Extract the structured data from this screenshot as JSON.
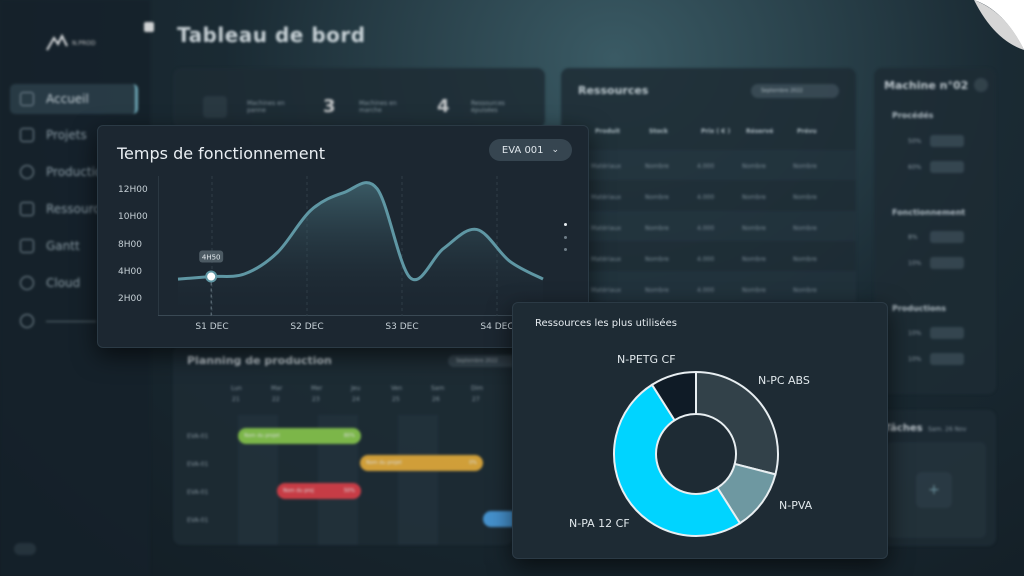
{
  "app": {
    "logo_text": "N.PROD",
    "page_title": "Tableau de bord"
  },
  "sidebar": {
    "items": [
      {
        "label": "Accueil",
        "icon": "home-icon"
      },
      {
        "label": "Projets",
        "icon": "folder-icon"
      },
      {
        "label": "Production",
        "icon": "gear-icon"
      },
      {
        "label": "Ressources",
        "icon": "bolt-icon"
      },
      {
        "label": "Gantt",
        "icon": "calendar-icon"
      },
      {
        "label": "Cloud",
        "icon": "cloud-icon"
      },
      {
        "label": "",
        "icon": "search-icon"
      }
    ]
  },
  "stats": [
    {
      "value": "",
      "label": "Machines en panne"
    },
    {
      "value": "3",
      "label": "Machines en marche"
    },
    {
      "value": "4",
      "label": "Ressources épuisées"
    }
  ],
  "resources_panel": {
    "title": "Ressources",
    "month": "Septembre 2022",
    "columns": [
      "Produit",
      "Stock",
      "Prix ( € )",
      "Réservé",
      "Prévu"
    ],
    "rows": [
      [
        "Matériaux",
        "Nombre",
        "4.000",
        "Nombre",
        "Nombre"
      ],
      [
        "Matériaux",
        "Nombre",
        "4.000",
        "Nombre",
        "Nombre"
      ],
      [
        "Matériaux",
        "Nombre",
        "4.000",
        "Nombre",
        "Nombre"
      ],
      [
        "Matériaux",
        "Nombre",
        "4.000",
        "Nombre",
        "Nombre"
      ],
      [
        "Matériaux",
        "Nombre",
        "4.000",
        "Nombre",
        "Nombre"
      ]
    ]
  },
  "machine_panel": {
    "title": "Machine n°02",
    "sections": [
      {
        "title": "Procédés",
        "rows": [
          "50%",
          "60%"
        ]
      },
      {
        "title": "Fonctionnement",
        "rows": [
          "8%",
          "10%"
        ]
      },
      {
        "title": "Productions",
        "rows": [
          "10%",
          "10%"
        ]
      }
    ]
  },
  "tasks_panel": {
    "title": "Tâches",
    "subtitle": "Sam. 26 Nov",
    "add": "+"
  },
  "planning": {
    "title": "Planning de production",
    "month": "Septembre 2022",
    "days": [
      [
        "Lun",
        "21"
      ],
      [
        "Mar",
        "22"
      ],
      [
        "Mer",
        "23"
      ],
      [
        "Jeu",
        "24"
      ],
      [
        "Ven",
        "25"
      ],
      [
        "Sam",
        "26"
      ],
      [
        "Dim",
        "27"
      ]
    ],
    "rows": [
      "EVA-01",
      "EVA-01",
      "EVA-01",
      "EVA-01"
    ],
    "bars": [
      {
        "label": "Nom du projet",
        "pct": "80%",
        "color": "#8fd14f"
      },
      {
        "label": "Nom du projet",
        "pct": "0%",
        "color": "#f2b53b"
      },
      {
        "label": "Nom du proj",
        "pct": "50%",
        "color": "#e8424b"
      },
      {
        "label": "",
        "pct": "",
        "color": "#4fa6ea"
      }
    ]
  },
  "uptime_card": {
    "title": "Temps de fonctionnement",
    "selector": "EVA 001",
    "tooltip": "4H50",
    "chart_data": {
      "type": "area",
      "title": "Temps de fonctionnement",
      "yticks": [
        "12H00",
        "10H00",
        "8H00",
        "4H00",
        "2H00"
      ],
      "xticks": [
        "S1 DEC",
        "S2 DEC",
        "S3 DEC",
        "S4 DEC"
      ],
      "series": [
        {
          "values": [
            4.4,
            4.6,
            4.8,
            6.5,
            9.8,
            11.2,
            11.5,
            4.5,
            6.8,
            8.3,
            5.8,
            4.4
          ]
        }
      ],
      "highlight": {
        "label": "4H50"
      }
    }
  },
  "donut_card": {
    "title": "Ressources les plus utilisées",
    "chart_data": {
      "type": "pie",
      "labels": [
        "N-PC ABS",
        "N-PVA",
        "N-PA 12 CF",
        "N-PETG CF"
      ],
      "values": [
        29,
        12,
        50,
        9
      ],
      "colors": [
        "#324149",
        "#6e98a1",
        "#00d4ff",
        "#0f1b26"
      ]
    }
  }
}
